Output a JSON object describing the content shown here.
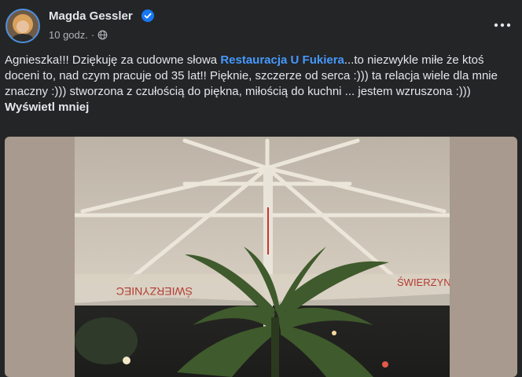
{
  "post": {
    "author": "Magda Gessler",
    "time": "10 godz.",
    "separator": "·",
    "text_before": "Agnieszka!!! Dziękuję za cudowne słowa ",
    "link_text": "Restauracja U Fukiera",
    "text_after": "...to niezwykle miłe że ktoś doceni to, nad czym pracuje od 35 lat!! Pięknie, szczerze od serca :))) ta relacja wiele dla mnie znaczny :))) stworzona z czułością do piękna, miłością do kuchni ... jestem wzruszona :))) ",
    "see_less": "Wyświetl mniej"
  },
  "photo": {
    "umbrella_print_left": "ŚWIERZYNIEC",
    "umbrella_print_right": "ŚWIERZYNIEC"
  },
  "icons": {
    "verified": "verified-badge-icon",
    "privacy": "globe-icon",
    "more": "more-options-icon"
  },
  "colors": {
    "background": "#242526",
    "link": "#4599ff",
    "verified": "#1877f2"
  }
}
